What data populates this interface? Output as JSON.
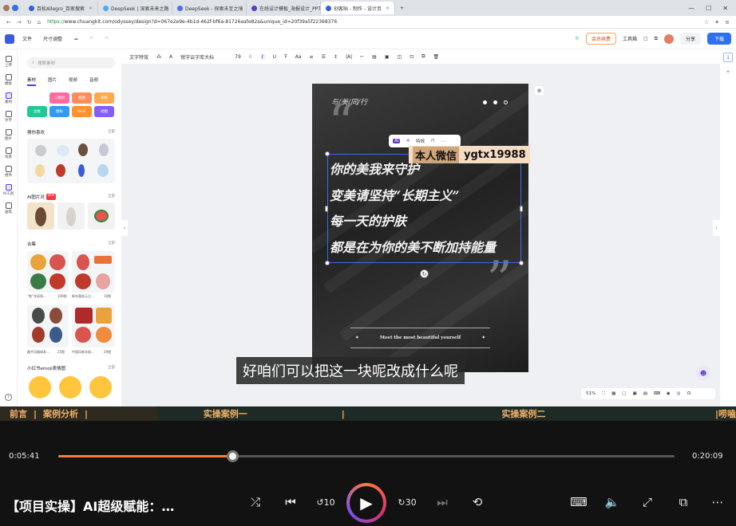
{
  "browser": {
    "tabs": [
      {
        "title": "百松Allegro_百家搜索",
        "color": "#3b5bdb"
      },
      {
        "title": "DeepSeek | 深索未来之路",
        "color": "#4dabf7"
      },
      {
        "title": "DeepSeek - 探索未至之境",
        "color": "#4c6ef5"
      },
      {
        "title": "在线设计模板_海报设计_PPT在…",
        "color": "#5f3dc4"
      },
      {
        "title": "创客贴 - 制作 - 设计页",
        "color": "#3b5bdb",
        "active": true
      }
    ],
    "url_scheme": "https://",
    "url_rest": "www.chuangkit.com/odyssey/design?d=067e2e9e-4b1d-462f-bf6a-81726aafe82a&unique_id=20f39a5f22368376"
  },
  "editor": {
    "menu_file": "文件",
    "menu_resize": "尺寸调整",
    "vip_label": "会员续费",
    "toolbox_label": "工具箱",
    "share_label": "分享",
    "download_label": "下载",
    "rail": [
      "上传",
      "模板",
      "素材",
      "文字",
      "图片",
      "背景",
      "组件",
      "AI工具",
      "画笔"
    ],
    "search_placeholder": "搜索素材",
    "asset_tabs": [
      "素材",
      "图片",
      "视频",
      "音频"
    ],
    "quick_tiles": [
      {
        "label": "二维码",
        "color": "#ff6b9d"
      },
      {
        "label": "抠图",
        "color": "#ff8c5a"
      },
      {
        "label": "表格",
        "color": "#ffa94d"
      },
      {
        "label": "边框",
        "color": "#20c997"
      },
      {
        "label": "图标",
        "color": "#339af0"
      },
      {
        "label": "AIGC",
        "color": "#ff922b"
      },
      {
        "label": "动图",
        "color": "#845ef7"
      }
    ],
    "sections": {
      "guess": "猜你喜欢",
      "ai_chat": "AI图片对",
      "ai_new_badge": "NEW",
      "collection": "合集",
      "xhs": "小红书emoji表情图",
      "all_label": "全部"
    },
    "collections": [
      {
        "name": "“乾”年彩纸…",
        "count": "106图"
      },
      {
        "name": "新年喜娃元旦…",
        "count": "10图"
      },
      {
        "name": "趣平风福禄寿…",
        "count": "25图"
      },
      {
        "name": "中国风新年插…",
        "count": "29图"
      }
    ],
    "format_bar": {
      "text_effects": "文字特效",
      "font_name": "锐字云字库大标",
      "font_size": "79"
    },
    "float_toolbar": {
      "effects_label": "特效"
    },
    "zoom": "51%"
  },
  "poster": {
    "title": "与/美/同/行",
    "open_quote": "“",
    "close_quote": "”",
    "lines": [
      "你的美我来守护",
      "变美请坚持“长期主义”",
      "每一天的护肤",
      "都是在为你的美不断加持能量"
    ],
    "slogan": "Meet  the  most  beautiful  yourself",
    "star_left": "✦",
    "star_right": "✦"
  },
  "watermark": {
    "label": "本人微信",
    "id": "ygtx19988"
  },
  "subtitle": "好咱们可以把这一块呢改成什么呢",
  "chapters": {
    "intro": "前言",
    "analysis": "案例分析",
    "case1": "实操案例一",
    "case2": "实操案例二",
    "tail": "唠嗑"
  },
  "player": {
    "current_time": "0:05:41",
    "total_time": "0:20:09",
    "progress_fraction": 0.2821,
    "video_title": "【项目实操】AI超级赋能：…",
    "skip_back": "10",
    "skip_fwd": "30"
  }
}
